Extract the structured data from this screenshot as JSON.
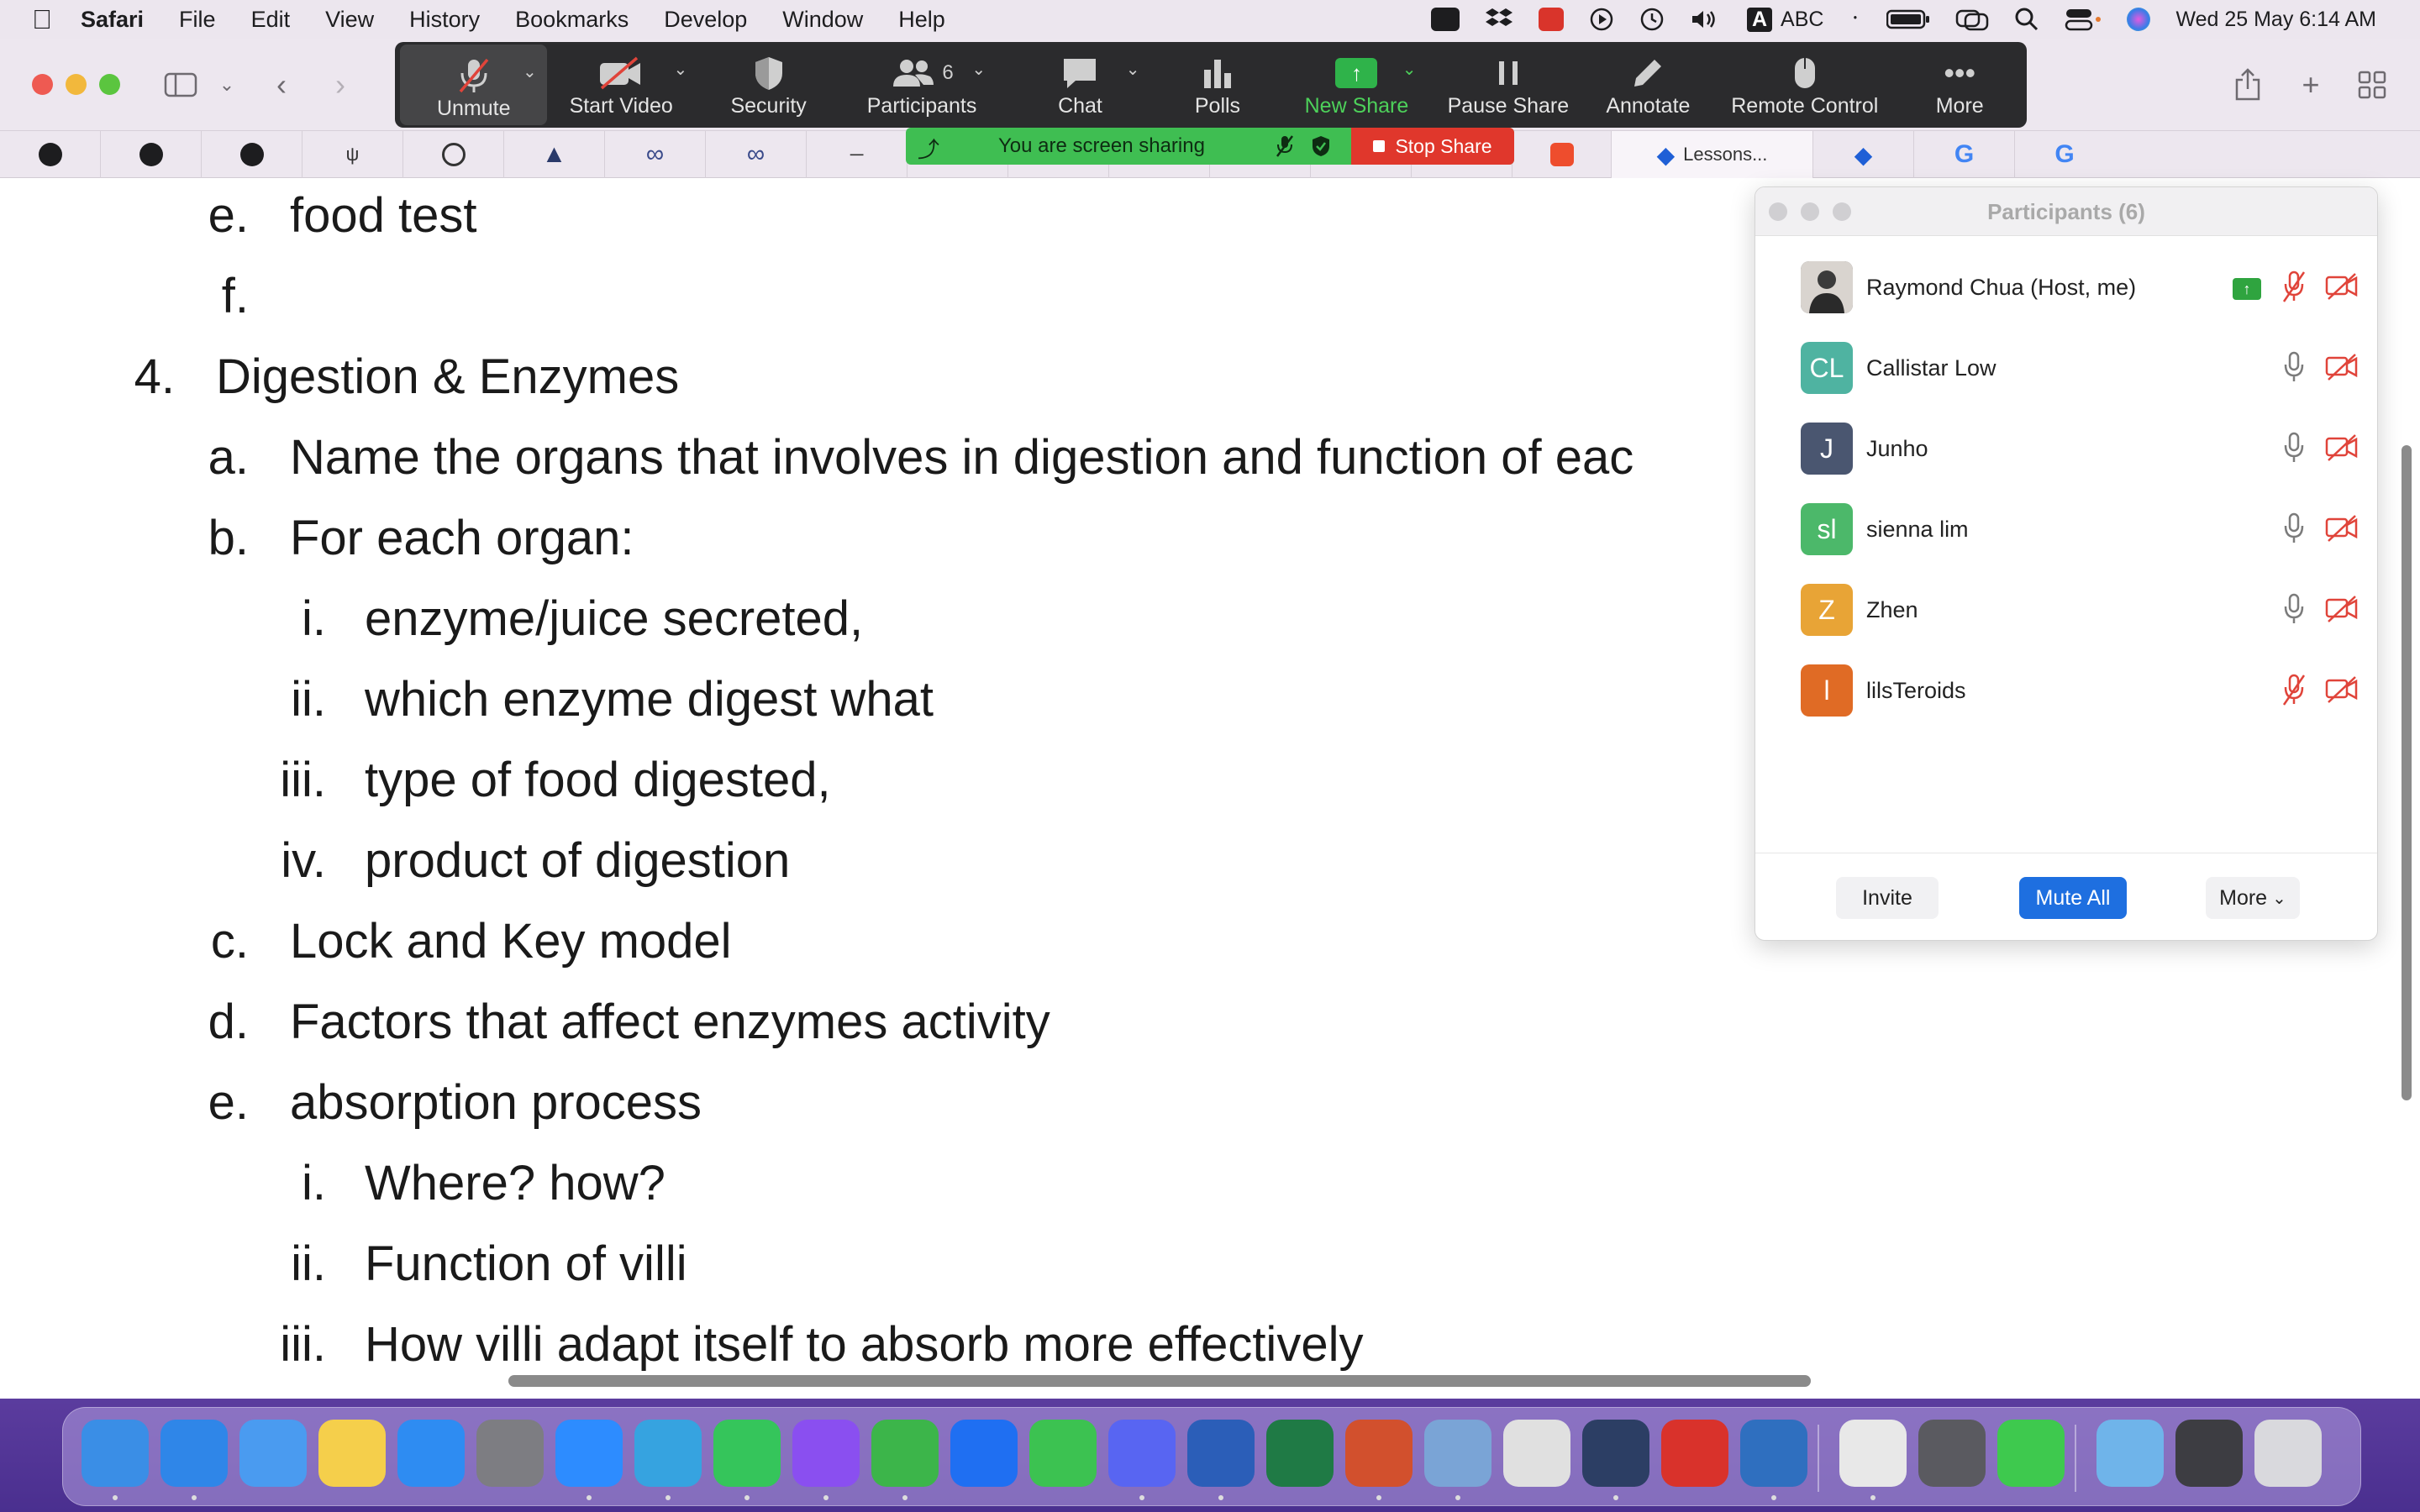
{
  "menubar": {
    "app_name": "Safari",
    "items": [
      "File",
      "Edit",
      "View",
      "History",
      "Bookmarks",
      "Develop",
      "Window",
      "Help"
    ],
    "input_source": "ABC",
    "datetime": "Wed 25 May  6:14 AM"
  },
  "favorites": {
    "active_tab_label": "Lessons..."
  },
  "zoom_toolbar": {
    "unmute": "Unmute",
    "start_video": "Start Video",
    "security": "Security",
    "participants": "Participants",
    "participants_count": "6",
    "chat": "Chat",
    "polls": "Polls",
    "new_share": "New Share",
    "pause_share": "Pause Share",
    "annotate": "Annotate",
    "remote_control": "Remote Control",
    "more": "More"
  },
  "share_banner": {
    "message": "You are screen sharing",
    "stop_label": "Stop Share"
  },
  "document": {
    "lines": [
      {
        "marker": "e.",
        "text": "food test"
      },
      {
        "marker": "f.",
        "text": ""
      },
      {
        "marker": "4.",
        "text": "Digestion & Enzymes"
      },
      {
        "marker": "a.",
        "text": "Name the organs that involves in digestion and function of eac"
      },
      {
        "marker": "b.",
        "text": "For each organ:"
      },
      {
        "marker": "i.",
        "text": "enzyme/juice secreted,"
      },
      {
        "marker": "ii.",
        "text": "which enzyme digest what"
      },
      {
        "marker": "iii.",
        "text": "type of food digested,"
      },
      {
        "marker": "iv.",
        "text": "product of digestion"
      },
      {
        "marker": "c.",
        "text": "Lock and Key model"
      },
      {
        "marker": "d.",
        "text": "Factors that affect enzymes activity"
      },
      {
        "marker": "e.",
        "text": "absorption process"
      },
      {
        "marker": "i.",
        "text": "Where? how?"
      },
      {
        "marker": "ii.",
        "text": "Function of villi"
      },
      {
        "marker": "iii.",
        "text": "How villi adapt itself to absorb more effectively"
      }
    ]
  },
  "participants_panel": {
    "title": "Participants (6)",
    "people": [
      {
        "name": "Raymond Chua (Host, me)",
        "initials": "",
        "color": "#6b6b6b",
        "muted": true,
        "video_off": true,
        "sharing": true
      },
      {
        "name": "Callistar Low",
        "initials": "CL",
        "color": "#4fb3a1",
        "muted": false,
        "video_off": true,
        "sharing": false
      },
      {
        "name": "Junho",
        "initials": "J",
        "color": "#4a5670",
        "muted": false,
        "video_off": true,
        "sharing": false
      },
      {
        "name": "sienna lim",
        "initials": "sl",
        "color": "#4cb86a",
        "muted": false,
        "video_off": true,
        "sharing": false
      },
      {
        "name": "Zhen",
        "initials": "Z",
        "color": "#e8a436",
        "muted": false,
        "video_off": true,
        "sharing": false
      },
      {
        "name": "lilsTeroids",
        "initials": "l",
        "color": "#e06b25",
        "muted": true,
        "video_off": true,
        "sharing": false
      }
    ],
    "invite": "Invite",
    "mute_all": "Mute All",
    "more": "More"
  },
  "dock": {
    "apps": [
      {
        "name": "Finder",
        "color": "#3a8ee6"
      },
      {
        "name": "Safari",
        "color": "#2f86e8"
      },
      {
        "name": "Mail",
        "color": "#4a9bf0"
      },
      {
        "name": "Notes",
        "color": "#f5cf4b"
      },
      {
        "name": "App Store",
        "color": "#2e8cf2"
      },
      {
        "name": "System Preferences",
        "color": "#7d7d82"
      },
      {
        "name": "Zoom",
        "color": "#2d8cff"
      },
      {
        "name": "Telegram",
        "color": "#36a3e0"
      },
      {
        "name": "WhatsApp",
        "color": "#35c55b"
      },
      {
        "name": "Messenger",
        "color": "#8a4ff0"
      },
      {
        "name": "Camtasia",
        "color": "#3cb54a"
      },
      {
        "name": "Dropbox",
        "color": "#1f6ff2"
      },
      {
        "name": "WeChat",
        "color": "#3cc251"
      },
      {
        "name": "Discord",
        "color": "#5865f2"
      },
      {
        "name": "Word",
        "color": "#2b5eb8"
      },
      {
        "name": "Excel",
        "color": "#1f7a45"
      },
      {
        "name": "PowerPoint",
        "color": "#d2502d"
      },
      {
        "name": "Preview",
        "color": "#7aa4d6"
      },
      {
        "name": "Readdle",
        "color": "#e0e0e0"
      },
      {
        "name": "QuickTime",
        "color": "#2c3e64"
      },
      {
        "name": "PDF Expert",
        "color": "#d9322b"
      },
      {
        "name": "MuseScore",
        "color": "#2f6fbf"
      },
      {
        "name": "Chrome",
        "color": "#e8e8e8"
      },
      {
        "name": "Sandbox",
        "color": "#5a5a60"
      },
      {
        "name": "FaceTime",
        "color": "#3ec94e"
      },
      {
        "name": "Downloads",
        "color": "#6fb4ea"
      },
      {
        "name": "Screenshot",
        "color": "#3d3d42"
      },
      {
        "name": "Trash",
        "color": "#d9d9dd"
      }
    ]
  }
}
